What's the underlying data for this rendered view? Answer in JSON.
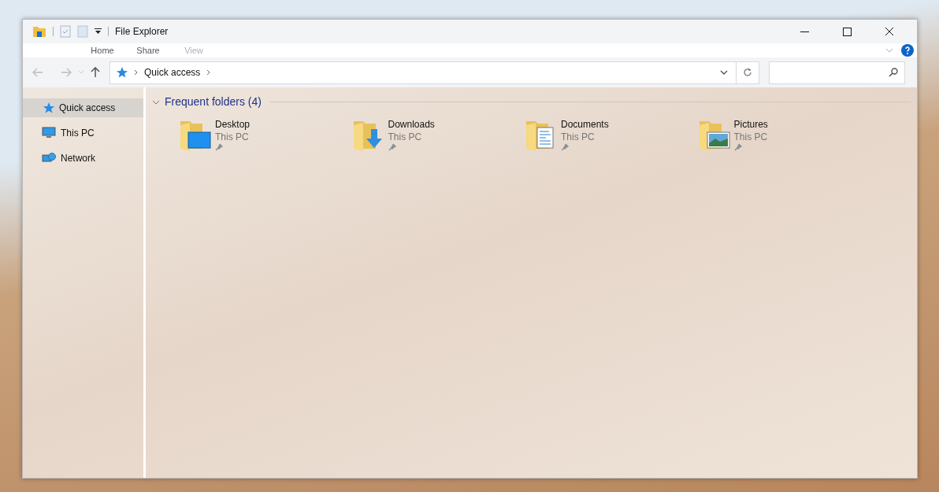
{
  "window": {
    "title": "File Explorer"
  },
  "ribbon_tabs": [
    {
      "label": "Home",
      "disabled": false
    },
    {
      "label": "Share",
      "disabled": false
    },
    {
      "label": "View",
      "disabled": true
    }
  ],
  "address_bar": {
    "path": [
      "Quick access"
    ]
  },
  "sidebar": {
    "items": [
      {
        "label": "Quick access",
        "kind": "star",
        "selected": true
      },
      {
        "label": "This PC",
        "kind": "pc",
        "selected": false
      },
      {
        "label": "Network",
        "kind": "network",
        "selected": false
      }
    ]
  },
  "section": {
    "title": "Frequent folders (4)",
    "expanded": true
  },
  "folders": [
    {
      "name": "Desktop",
      "location": "This PC",
      "kind": "desktop",
      "pinned": true
    },
    {
      "name": "Downloads",
      "location": "This PC",
      "kind": "downloads",
      "pinned": true
    },
    {
      "name": "Documents",
      "location": "This PC",
      "kind": "documents",
      "pinned": true
    },
    {
      "name": "Pictures",
      "location": "This PC",
      "kind": "pictures",
      "pinned": true
    }
  ]
}
